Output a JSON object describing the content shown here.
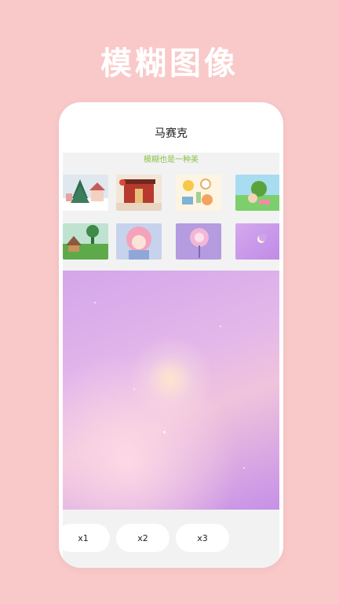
{
  "promo": {
    "title": "模糊图像"
  },
  "header": {
    "title": "马赛克"
  },
  "subtitle": "模糊也是一种美",
  "thumbnails": [
    {
      "name": "thumb-snow-village"
    },
    {
      "name": "thumb-red-gate"
    },
    {
      "name": "thumb-breakfast-table"
    },
    {
      "name": "thumb-girl-in-grass"
    },
    {
      "name": "thumb-forest-cabin"
    },
    {
      "name": "thumb-pink-hair-girl"
    },
    {
      "name": "thumb-glowing-rose"
    },
    {
      "name": "thumb-purple-moon"
    }
  ],
  "preview": {
    "name": "purple-moon-mosaic"
  },
  "buttons": [
    {
      "label": "x1"
    },
    {
      "label": "x2"
    },
    {
      "label": "x3"
    }
  ],
  "colors": {
    "background": "#f9c9c9",
    "accent_green": "#8bc34a",
    "preview_purple": "#d3a6ea"
  }
}
